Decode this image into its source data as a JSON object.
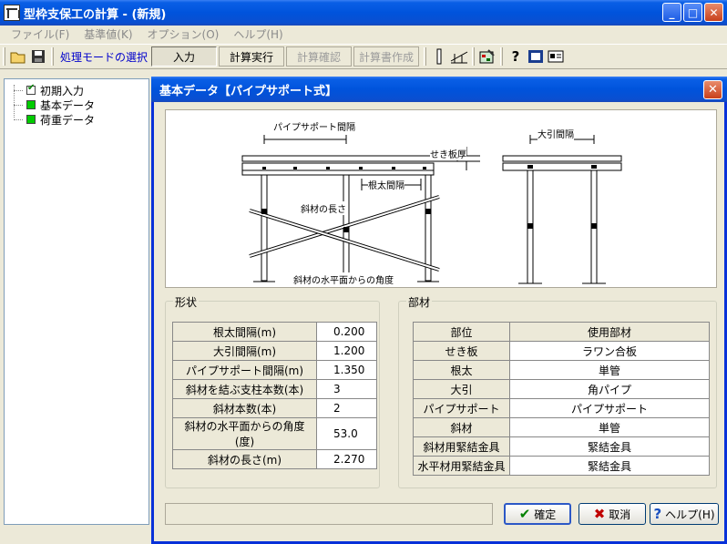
{
  "window": {
    "title": "型枠支保工の計算 - (新規)"
  },
  "menu": [
    {
      "label": "ファイル(F)"
    },
    {
      "label": "基準値(K)"
    },
    {
      "label": "オプション(O)"
    },
    {
      "label": "ヘルプ(H)"
    }
  ],
  "toolbar": {
    "mode_label": "処理モードの選択",
    "buttons": [
      "入力",
      "計算実行",
      "計算確認",
      "計算書作成"
    ]
  },
  "tree": {
    "items": [
      "初期入力",
      "基本データ",
      "荷重データ"
    ]
  },
  "dialog": {
    "title": "基本データ【パイプサポート式】",
    "figure_labels": {
      "pipe_spacing": "パイプサポート間隔",
      "slab_thickness": "せき板厚",
      "joist_spacing": "根太間隔",
      "brace_length": "斜材の長さ",
      "brace_angle": "斜材の水平面からの角度",
      "beam_spacing": "大引間隔"
    },
    "shape_group": {
      "title": "形状",
      "rows": [
        {
          "label": "根太間隔(m)",
          "value": "0.200"
        },
        {
          "label": "大引間隔(m)",
          "value": "1.200"
        },
        {
          "label": "パイプサポート間隔(m)",
          "value": "1.350"
        },
        {
          "label": "斜材を結ぶ支柱本数(本)",
          "value": "3"
        },
        {
          "label": "斜材本数(本)",
          "value": "2"
        },
        {
          "label": "斜材の水平面からの角度(度)",
          "value": "53.0"
        },
        {
          "label": "斜材の長さ(m)",
          "value": "2.270"
        }
      ]
    },
    "member_group": {
      "title": "部材",
      "headers": [
        "部位",
        "使用部材"
      ],
      "rows": [
        {
          "part": "せき板",
          "material": "ラワン合板"
        },
        {
          "part": "根太",
          "material": "単管"
        },
        {
          "part": "大引",
          "material": "角パイプ"
        },
        {
          "part": "パイプサポート",
          "material": "パイプサポート"
        },
        {
          "part": "斜材",
          "material": "単管"
        },
        {
          "part": "斜材用緊結金具",
          "material": "緊結金具"
        },
        {
          "part": "水平材用緊結金具",
          "material": "緊結金具"
        }
      ]
    },
    "buttons": {
      "ok": "確定",
      "cancel": "取消",
      "help": "ヘルプ(H)"
    }
  }
}
